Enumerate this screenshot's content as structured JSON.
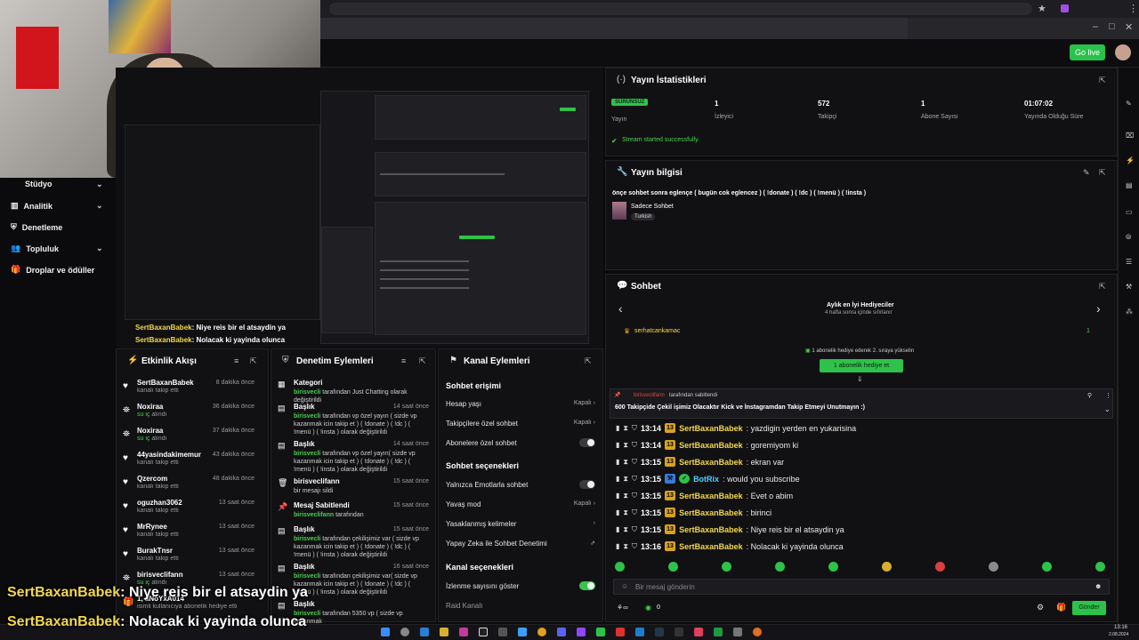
{
  "webcam": {
    "label": "Webcam"
  },
  "sidebar": {
    "items": [
      {
        "label": "Stüdyo",
        "icon": "chevron-down-icon"
      },
      {
        "label": "Analitik",
        "icon": "chevron-down-icon"
      },
      {
        "label": "Denetleme"
      },
      {
        "label": "Topluluk",
        "icon": "chevron-down-icon"
      },
      {
        "label": "Droplar ve ödüller"
      }
    ]
  },
  "topbar": {
    "go_live": "Go live"
  },
  "overlay_chat": [
    {
      "user": "SertBaxanBabek",
      "text": ": Niye reis bir el atsaydin ya"
    },
    {
      "user": "SertBaxanBabek",
      "text": ": Nolacak ki yayinda olunca"
    }
  ],
  "activity_feed": {
    "title": "Etkinlik Akışı",
    "items": [
      {
        "name": "SertBaxanBabek",
        "desc": "kanalı takip etti",
        "time": "8 dakika önce",
        "icon": "heart-icon"
      },
      {
        "name": "Noxiraa",
        "desc_green": "su iç",
        "desc": " alındı",
        "time": "36 dakika önce",
        "icon": "reward-icon"
      },
      {
        "name": "Noxiraa",
        "desc_green": "su iç",
        "desc": " alındı",
        "time": "37 dakika önce",
        "icon": "reward-icon"
      },
      {
        "name": "44yasindakimemur",
        "desc": "kanalı takip etti",
        "time": "43 dakika önce",
        "icon": "heart-icon"
      },
      {
        "name": "Qzercom",
        "desc": "kanalı takip etti",
        "time": "48 dakika önce",
        "icon": "heart-icon"
      },
      {
        "name": "oguzhan3062",
        "desc": "kanalı takip etti",
        "time": "13 saat önce",
        "icon": "heart-icon"
      },
      {
        "name": "MrRynee",
        "desc": "kanalı takip etti",
        "time": "13 saat önce",
        "icon": "heart-icon"
      },
      {
        "name": "BurakTnsr",
        "desc": "kanalı takip etti",
        "time": "13 saat önce",
        "icon": "heart-icon"
      },
      {
        "name": "birisveclifann",
        "desc_green": "su iç",
        "desc": " alındı",
        "time": "13 saat önce",
        "icon": "reward-icon"
      },
      {
        "name": "1, aNoYxA014",
        "desc": "isimli kullanıcıya abonelik hediye etti",
        "time": "",
        "icon": "gift-icon"
      }
    ]
  },
  "moderation": {
    "title": "Denetim Eylemleri",
    "items": [
      {
        "name": "Kategori",
        "time": "",
        "desc_user": "birisvecli",
        "desc": " tarafından Just Chatting olarak değiştirildi",
        "icon": "category-icon"
      },
      {
        "name": "Başlık",
        "time": "14 saat önce",
        "desc_user": "birisvecli",
        "desc": " tarafından vp özel yayın ( sizde vp kazanmak icin takip et ) ( !donate ) ( !dc ) ( !menü ) ( !insta ) olarak değiştirildi",
        "icon": "title-icon"
      },
      {
        "name": "Başlık",
        "time": "14 saat önce",
        "desc_user": "birisvecli",
        "desc": " tarafından vp özel yayın( sizde vp kazanmak icin takip et ) ( !donate ) ( !dc ) ( !menü ) ( !insta ) olarak değiştirildi",
        "icon": "title-icon"
      },
      {
        "name": "birisveclifann",
        "time": "15 saat önce",
        "desc_user": "",
        "desc": "bir mesajı sildi",
        "icon": "trash-icon"
      },
      {
        "name": "Mesaj Sabitlendi",
        "time": "15 saat önce",
        "desc_user": "birisveclifann",
        "desc": " tarafından",
        "icon": "pin-icon"
      },
      {
        "name": "Başlık",
        "time": "15 saat önce",
        "desc_user": "birisvecli",
        "desc": " tarafından çekilişimiz var ( sizde vp kazanmak icin takip et ) ( !donate ) ( !dc ) ( !menü ) ( !insta ) olarak değiştirildi",
        "icon": "title-icon"
      },
      {
        "name": "Başlık",
        "time": "16 saat önce",
        "desc_user": "birisvecli",
        "desc": " tarafından çekilişimiz var( sizde vp kazanmak icin takip et ) ( !donate ) ( !dc ) ( !menü ) ( !insta ) olarak değiştirildi",
        "icon": "title-icon"
      },
      {
        "name": "Başlık",
        "time": "",
        "desc_user": "birisvecli",
        "desc": " tarafından 5350 vp ( sizde vp kazanmak",
        "icon": "title-icon"
      }
    ]
  },
  "channel_actions": {
    "title": "Kanal Eylemleri",
    "sections": {
      "chat_access": "Sohbet erişimi",
      "chat_options": "Sohbet seçenekleri",
      "channel_options": "Kanal seçenekleri"
    },
    "rows": {
      "account_age": {
        "label": "Hesap yaşı",
        "value": "Kapalı"
      },
      "followers_only": {
        "label": "Takipçilere özel sohbet",
        "value": "Kapalı"
      },
      "subs_only": {
        "label": "Abonelere özel sohbet"
      },
      "emote_only": {
        "label": "Yalnızca Emotlarla sohbet"
      },
      "slow_mode": {
        "label": "Yavaş mod",
        "value": "Kapalı"
      },
      "banned_words": {
        "label": "Yasaklanmış kelimeler"
      },
      "ai_moderation": {
        "label": "Yapay Zeka ile Sohbet Denetimi"
      },
      "viewer_count": {
        "label": "İzlenme sayısını göster"
      },
      "raid": {
        "label": "Raid Kanalı"
      }
    }
  },
  "stats": {
    "title": "Yayın İstatistikleri",
    "status_badge": "SÜRÜNSÜZ",
    "status_label": "Yayın",
    "viewers": {
      "value": "1",
      "label": "İzleyici"
    },
    "followers": {
      "value": "572",
      "label": "Takipçi"
    },
    "subs": {
      "value": "1",
      "label": "Abone Sayısı"
    },
    "uptime": {
      "value": "01:07:02",
      "label": "Yayında Olduğu Süre"
    },
    "success": "Stream started successfully."
  },
  "stream_info": {
    "title": "Yayın bilgisi",
    "stream_title": "önçe sohbet sonra eglençe ( bugün cok eglencez ) ( !donate ) ( !dc ) ( !menü ) ( !insta )",
    "category": "Sadece Sohbet",
    "language": "Turkish"
  },
  "chat": {
    "title": "Sohbet",
    "gifters_title": "Aylık en İyi Hediyeciler",
    "gifters_sub": "4 hafta sonra içinde sıfırlanır",
    "top_gifter": "serhatcankamac",
    "top_gifter_count": "1",
    "gift_hint": "1 abonelik hediye ederek 2. sıraya yükselin",
    "gift_button": "1 abonelik hediye et",
    "pinned_by": "birisveclifann",
    "pinned_by_suffix": " tarafından sabitlendi",
    "pinned_text": "600 Takipçide Çekil işimiz Olacaktır Kick ve İnstagramdan Takip Etmeyi Unutmayın :)",
    "messages": [
      {
        "time": "13:14",
        "badge": "13",
        "user": "SertBaxanBabek",
        "text": ": yazdigin yerden en yukarisina",
        "bot": false
      },
      {
        "time": "13:14",
        "badge": "13",
        "user": "SertBaxanBabek",
        "text": ": goremiyom ki",
        "bot": false
      },
      {
        "time": "13:15",
        "badge": "13",
        "user": "SertBaxanBabek",
        "text": ": ekran var",
        "bot": false
      },
      {
        "time": "13:15",
        "badge": "",
        "user": "BotRix",
        "text": ": would you subscribe",
        "bot": true
      },
      {
        "time": "13:15",
        "badge": "13",
        "user": "SertBaxanBabek",
        "text": ": Evet o abim",
        "bot": false
      },
      {
        "time": "13:15",
        "badge": "13",
        "user": "SertBaxanBabek",
        "text": ": birinci",
        "bot": false
      },
      {
        "time": "13:15",
        "badge": "13",
        "user": "SertBaxanBabek",
        "text": ": Niye reis bir el atsaydin ya",
        "bot": false
      },
      {
        "time": "13:16",
        "badge": "13",
        "user": "SertBaxanBabek",
        "text": ": Nolacak ki yayinda olunca",
        "bot": false
      }
    ],
    "input_placeholder": "Bir mesaj gönderin",
    "send_button": "Gönder",
    "points": "0"
  },
  "subtitles": [
    {
      "user": "SertBaxanBabek",
      "text": ": Niye reis bir el atsaydin ya"
    },
    {
      "user": "SertBaxanBabek",
      "text": ": Nolacak ki yayinda olunca"
    }
  ],
  "taskbar": {
    "time": "13:16",
    "date": "2.08.2024"
  },
  "colors": {
    "accent": "#2ec24a",
    "username": "#f4d84a",
    "bot": "#4fd0ff",
    "badge": "#d9a21b"
  }
}
